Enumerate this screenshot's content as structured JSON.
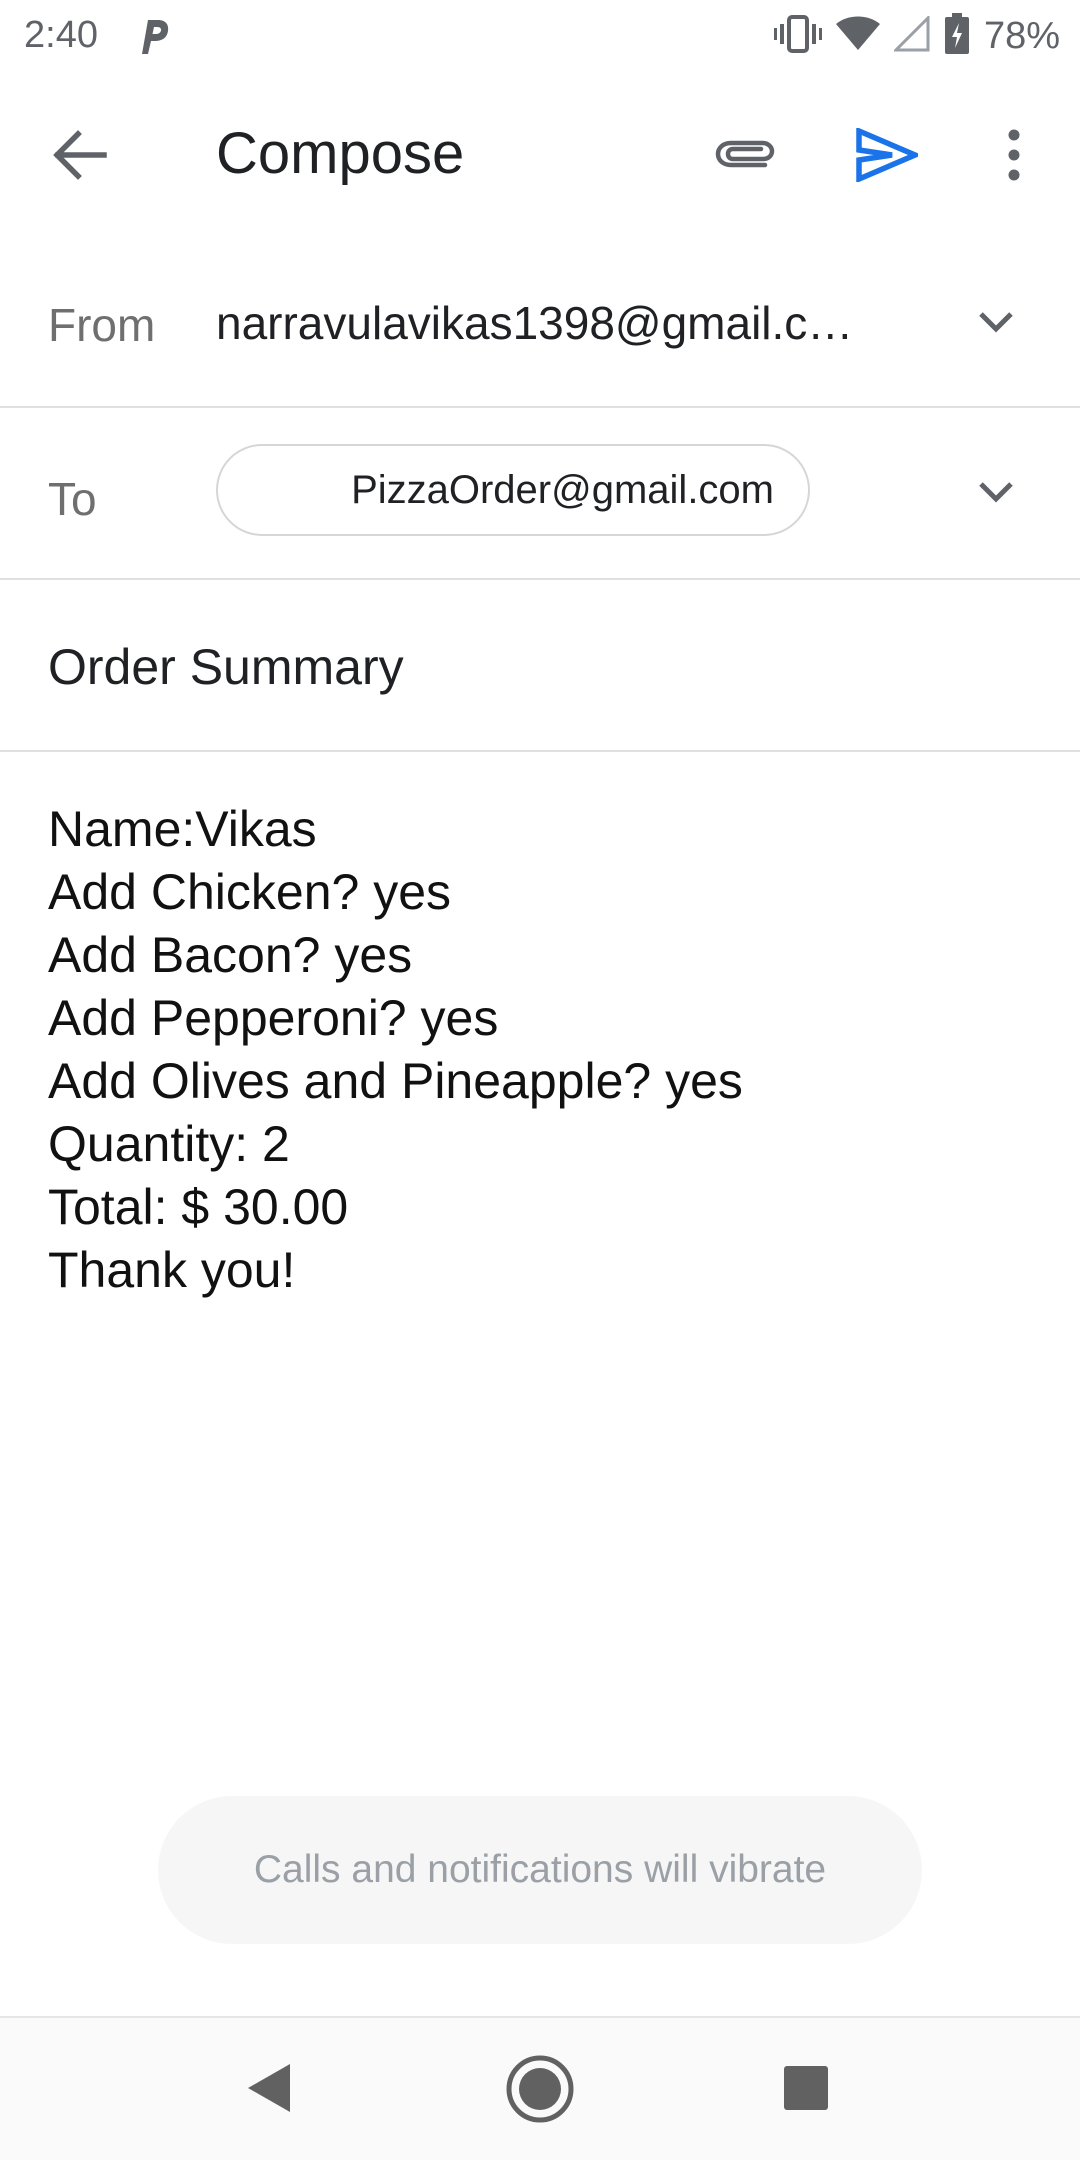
{
  "status_bar": {
    "time": "2:40",
    "battery": "78%"
  },
  "toolbar": {
    "title": "Compose",
    "icons": [
      "back-arrow-icon",
      "paperclip-icon",
      "send-icon",
      "more-vert-icon"
    ],
    "send_color": "#1a73e8"
  },
  "from": {
    "label": "From",
    "value": "narravulavikas1398@gmail.c…"
  },
  "to": {
    "label": "To",
    "recipient": "PizzaOrder@gmail.com"
  },
  "subject": "Order Summary",
  "body": {
    "lines": [
      "Name:Vikas",
      "Add Chicken? yes",
      "Add Bacon? yes",
      "Add Pepperoni? yes",
      "Add Olives and Pineapple? yes",
      "Quantity: 2",
      "Total: $ 30.00",
      "Thank you!"
    ]
  },
  "toast": "Calls and notifications will vibrate",
  "nav_bar": {
    "icons": [
      "nav-back-icon",
      "nav-home-icon",
      "nav-recents-icon"
    ]
  }
}
